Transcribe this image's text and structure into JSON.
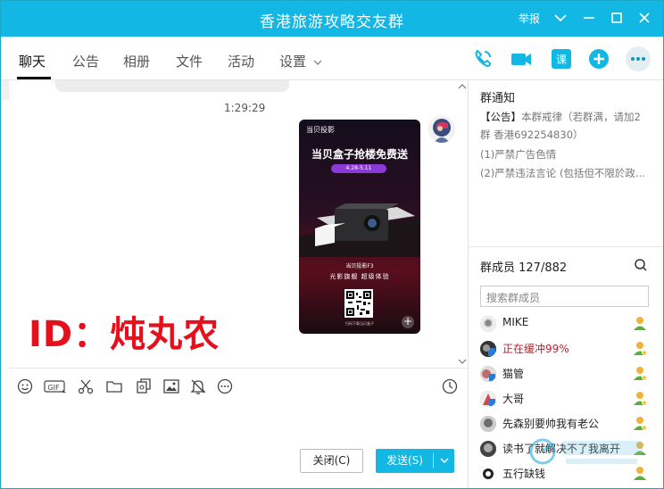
{
  "window": {
    "title": "香港旅游攻略交友群",
    "report_label": "举报"
  },
  "tabs": [
    {
      "label": "聊天",
      "active": true
    },
    {
      "label": "公告",
      "active": false
    },
    {
      "label": "相册",
      "active": false
    },
    {
      "label": "文件",
      "active": false
    },
    {
      "label": "活动",
      "active": false
    },
    {
      "label": "设置",
      "active": false
    }
  ],
  "header_icons": [
    "phone-call-icon",
    "video-call-icon",
    "lesson-icon",
    "add-app-icon",
    "more-icon"
  ],
  "chat": {
    "timestamp": "1:29:29",
    "poster": {
      "brand": "当贝投影",
      "headline": "当贝盒子抢楼免费送",
      "date_range": "4.28-5.11",
      "model": "当贝投影F3",
      "slogan": "光影旗舰 超级体验",
      "qr_caption": "扫码下载当贝盒子"
    },
    "overlay_text": "ID：炖丸农"
  },
  "toolbar": {
    "icons": [
      "emoji-icon",
      "gif-icon",
      "scissors-icon",
      "folder-icon",
      "file-transfer-icon",
      "image-icon",
      "bell-off-icon",
      "more-circle-icon",
      "history-clock-icon"
    ],
    "gif_label": "GIF"
  },
  "buttons": {
    "close": "关闭(C)",
    "send": "发送(S)"
  },
  "notice": {
    "title": "群通知",
    "line1_tag": "【公告】",
    "line1_text": "本群戒律（若群满，请加2",
    "line2": "群 香港692254830）",
    "line3": "(1)严禁广告色情",
    "line4": "(2)严禁违法言论 (包括但不限於政..."
  },
  "members": {
    "title": "群成员 127/882",
    "search_placeholder": "搜索群成员",
    "list": [
      {
        "name": "MIKE",
        "highlight": false,
        "role": "owner"
      },
      {
        "name": "正在缓冲99%",
        "highlight": true,
        "role": "admin"
      },
      {
        "name": "猫管",
        "highlight": false,
        "role": "admin"
      },
      {
        "name": "大哥",
        "highlight": false,
        "role": "admin"
      },
      {
        "name": "先森别要帅我有老公",
        "highlight": false,
        "role": "admin"
      },
      {
        "name": "读书了就解决不了我离开",
        "highlight": false,
        "role": "admin"
      },
      {
        "name": "五行缺钱",
        "highlight": false,
        "role": "admin"
      }
    ]
  },
  "colors": {
    "accent": "#12b7e3",
    "watermark": "#e5101c",
    "member_highlight": "#b3262b"
  }
}
